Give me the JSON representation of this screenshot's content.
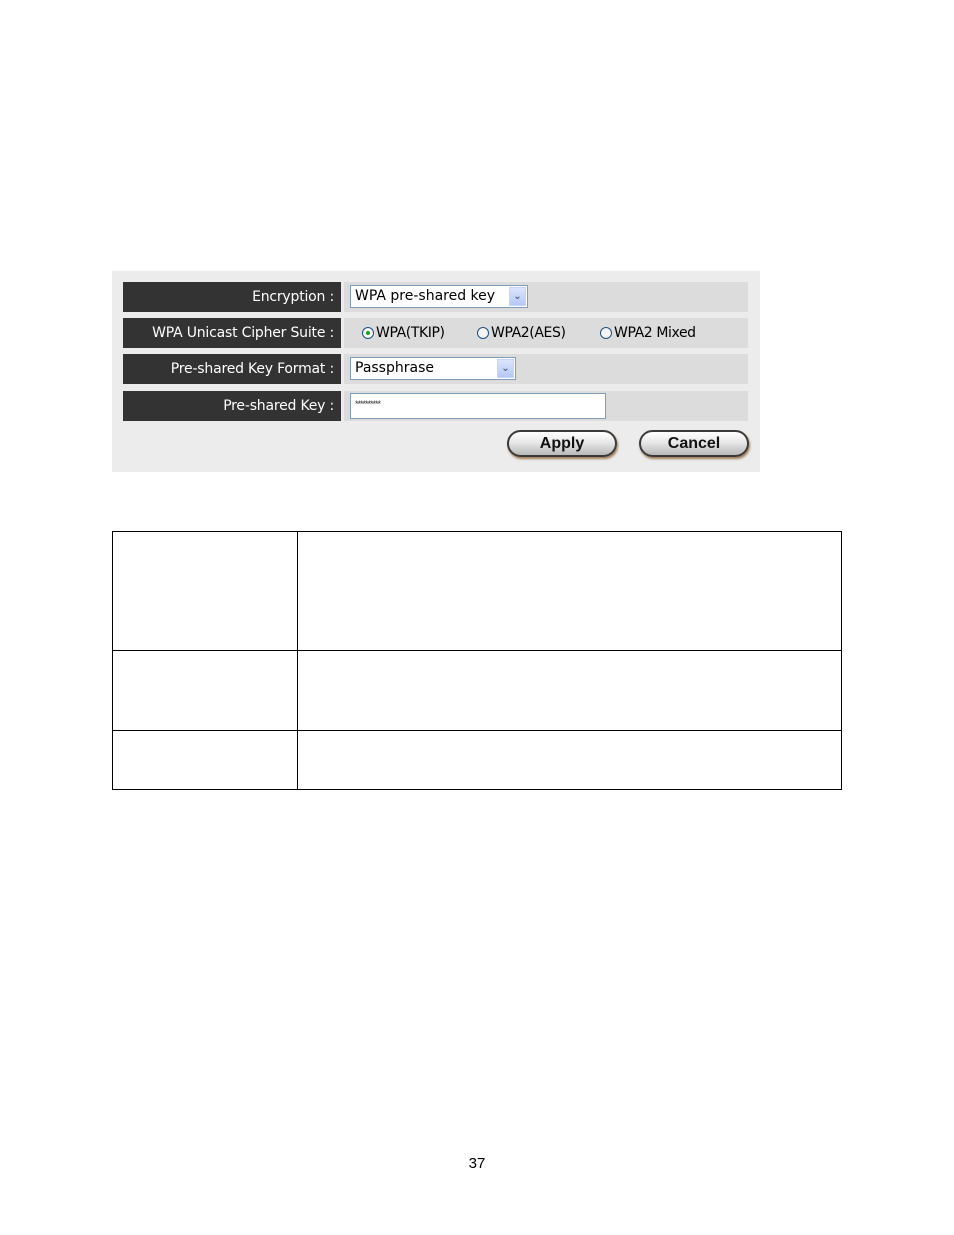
{
  "settings_panel": {
    "encryption": {
      "label": "Encryption :",
      "selected": "WPA pre-shared key"
    },
    "cipher_suite": {
      "label": "WPA Unicast Cipher Suite :",
      "options": [
        {
          "label": "WPA(TKIP)",
          "checked": true
        },
        {
          "label": "WPA2(AES)",
          "checked": false
        },
        {
          "label": "WPA2 Mixed",
          "checked": false
        }
      ]
    },
    "key_format": {
      "label": "Pre-shared Key Format :",
      "selected": "Passphrase"
    },
    "preshared_key": {
      "label": "Pre-shared Key :",
      "value": "**********"
    },
    "buttons": {
      "apply": "Apply",
      "cancel": "Cancel"
    },
    "dropdown_icon": "chevron-down-icon"
  },
  "description_table": {
    "rows": [
      {
        "term": "",
        "description": ""
      },
      {
        "term": "",
        "description": ""
      },
      {
        "term": "",
        "description": ""
      }
    ]
  },
  "footer": {
    "page_number": "37"
  }
}
